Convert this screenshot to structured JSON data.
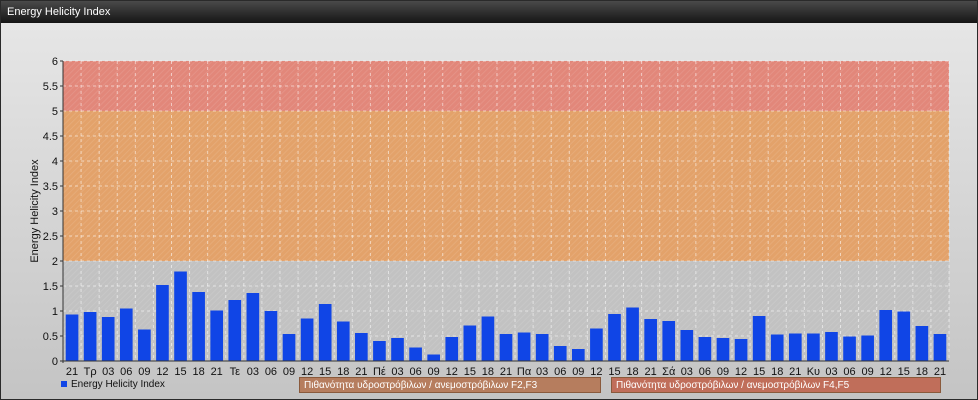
{
  "window": {
    "title": "Energy Helicity Index"
  },
  "colors": {
    "bar": "#1045e6",
    "zone_low": "#c2c2c2",
    "zone_mid": "#e3a26a",
    "zone_high": "#e2877a",
    "zone_box_mid": "#b67d5e",
    "zone_box_high": "#c06e5a"
  },
  "chart_data": {
    "type": "bar",
    "ylabel": "Energy Helicity Index",
    "ylim": [
      0,
      6
    ],
    "yticks": [
      "0",
      "0.5",
      "1",
      "1.5",
      "2",
      "2.5",
      "3",
      "3.5",
      "4",
      "4.5",
      "5",
      "5.5",
      "6"
    ],
    "grid": true,
    "legend_position": "bottom-left",
    "thresholds": [
      2,
      5
    ],
    "categories": [
      "21",
      "Τρ",
      "03",
      "06",
      "09",
      "12",
      "15",
      "18",
      "21",
      "Τε",
      "03",
      "06",
      "09",
      "12",
      "15",
      "18",
      "21",
      "Πέ",
      "03",
      "06",
      "09",
      "12",
      "15",
      "18",
      "21",
      "Πα",
      "03",
      "06",
      "09",
      "12",
      "15",
      "18",
      "21",
      "Σά",
      "03",
      "06",
      "09",
      "12",
      "15",
      "18",
      "21",
      "Κυ",
      "03",
      "06",
      "09",
      "12",
      "15",
      "18",
      "21"
    ],
    "series": [
      {
        "name": "Energy Helicity Index",
        "values": [
          0.93,
          0.98,
          0.88,
          1.05,
          0.63,
          1.52,
          1.79,
          1.38,
          1.01,
          1.22,
          1.36,
          1.0,
          0.54,
          0.85,
          1.14,
          0.79,
          0.56,
          0.4,
          0.46,
          0.27,
          0.13,
          0.48,
          0.71,
          0.89,
          0.54,
          0.57,
          0.54,
          0.3,
          0.24,
          0.65,
          0.94,
          1.07,
          0.84,
          0.8,
          0.62,
          0.48,
          0.46,
          0.44,
          0.9,
          0.53,
          0.55,
          0.55,
          0.58,
          0.49,
          0.51,
          1.02,
          0.99,
          0.7,
          0.54
        ]
      }
    ]
  },
  "legend": {
    "series_label": "Energy Helicity Index",
    "zone_mid_label": "Πιθανότητα υδροστρόβιλων / ανεμοστρόβιλων F2,F3",
    "zone_high_label": "Πιθανότητα υδροστρόβιλων / ανεμοστρόβιλων F4,F5"
  }
}
